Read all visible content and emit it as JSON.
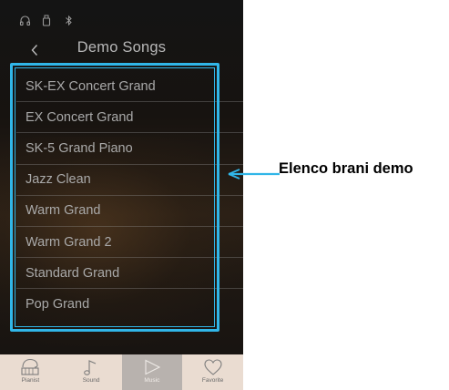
{
  "status_icons": [
    "headphones-icon",
    "usb-drive-icon",
    "bluetooth-icon"
  ],
  "header": {
    "title": "Demo Songs",
    "back_icon": "chevron-left-icon"
  },
  "songs": [
    "SK-EX Concert Grand",
    "EX Concert Grand",
    "SK-5 Grand Piano",
    "Jazz Clean",
    "Warm Grand",
    "Warm Grand 2",
    "Standard Grand",
    "Pop Grand"
  ],
  "tabs": [
    {
      "label": "Pianist",
      "icon": "piano-keys-icon",
      "active": false
    },
    {
      "label": "Sound",
      "icon": "music-note-icon",
      "active": false
    },
    {
      "label": "Music",
      "icon": "play-icon",
      "active": true
    },
    {
      "label": "Favorite",
      "icon": "heart-icon",
      "active": false
    }
  ],
  "callout": {
    "label": "Elenco brani demo"
  },
  "colors": {
    "highlight": "#31b6e8",
    "tab_bar": "#eadcd1",
    "tab_active": "#b8b2ae",
    "list_text": "#a9a9a9"
  }
}
